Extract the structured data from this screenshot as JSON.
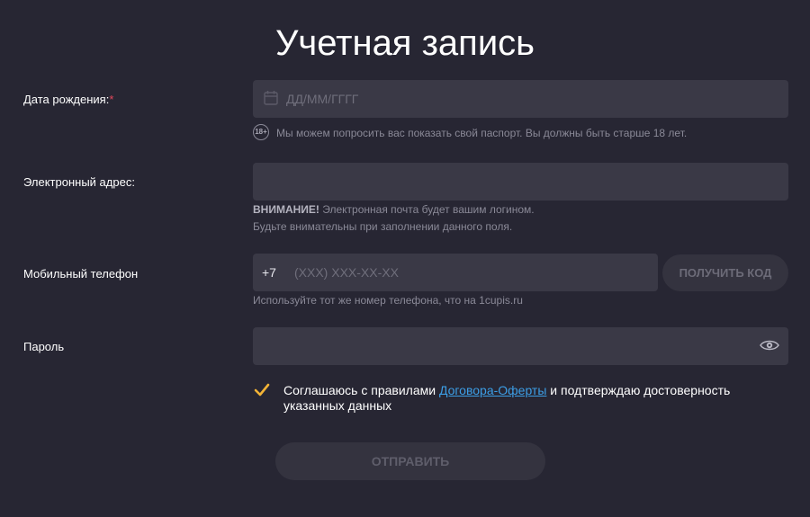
{
  "page": {
    "title": "Учетная запись"
  },
  "colors": {
    "background": "#272633",
    "field": "#3a3946",
    "link": "#3c9ee6",
    "required": "#e0475b",
    "checkmark": "#f2b336"
  },
  "birth_date": {
    "label": "Дата рождения:",
    "required_mark": "*",
    "placeholder": "ДД/ММ/ГГГГ",
    "icon": "calendar-icon",
    "age_badge": "18+",
    "hint": "Мы можем попросить вас показать свой паспорт. Вы должны быть старше 18 лет."
  },
  "email": {
    "label": "Электронный адрес:",
    "value": "",
    "warning_strong": "ВНИМАНИЕ!",
    "warning_text": " Электронная почта будет вашим логином.",
    "warning_line2": "Будьте внимательны при заполнении данного поля."
  },
  "phone": {
    "label": "Мобильный телефон",
    "prefix": "+7",
    "placeholder": "(XXX) XXX-XX-XX",
    "get_code_label": "ПОЛУЧИТЬ КОД",
    "hint": "Используйте тот же номер телефона, что на 1cupis.ru"
  },
  "password": {
    "label": "Пароль",
    "value": "",
    "icon": "eye-icon"
  },
  "agreement": {
    "checked": true,
    "text_before": "Соглашаюсь с правилами ",
    "link_text": "Договора-Оферты",
    "text_after": " и подтверждаю достоверность указанных данных"
  },
  "submit": {
    "label": "ОТПРАВИТЬ"
  }
}
